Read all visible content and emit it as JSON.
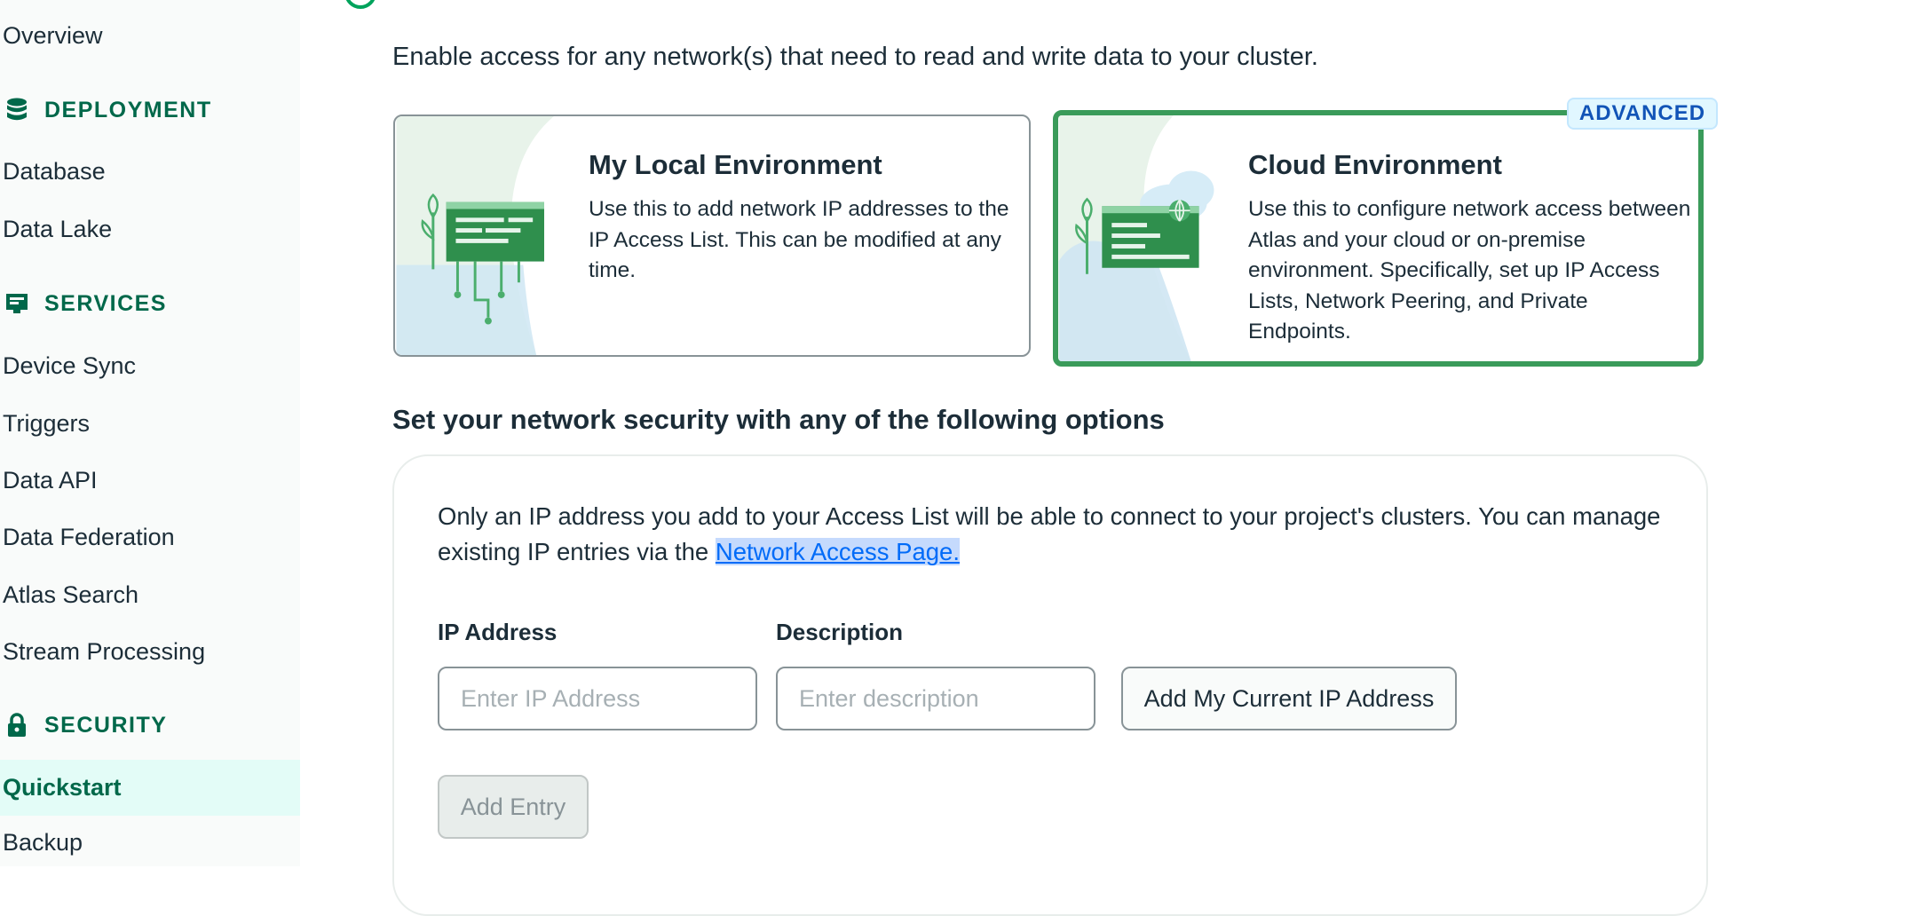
{
  "sidebar": {
    "overview": "Overview",
    "deployment": {
      "heading": "DEPLOYMENT",
      "items": [
        "Database",
        "Data Lake"
      ]
    },
    "services": {
      "heading": "SERVICES",
      "items": [
        "Device Sync",
        "Triggers",
        "Data API",
        "Data Federation",
        "Atlas Search",
        "Stream Processing"
      ]
    },
    "security": {
      "heading": "SECURITY",
      "items": [
        "Quickstart",
        "Backup"
      ],
      "active": "Quickstart"
    }
  },
  "main": {
    "intro": "Enable access for any network(s) that need to read and write data to your cluster.",
    "env_cards": [
      {
        "title": "My Local Environment",
        "description": "Use this to add network IP addresses to the IP Access List. This can be modified at any time."
      },
      {
        "title": "Cloud Environment",
        "description": "Use this to configure network access between Atlas and your cloud or on-premise environment. Specifically, set up IP Access Lists, Network Peering, and Private Endpoints.",
        "badge": "ADVANCED",
        "selected": true
      }
    ],
    "network_section": {
      "title": "Set your network security with any of the following options",
      "description": "Only an IP address you add to your Access List will be able to connect to your project's clusters. You can manage existing IP entries via the ",
      "link": "Network Access Page.",
      "ip_label": "IP Address",
      "ip_placeholder": "Enter IP Address",
      "desc_label": "Description",
      "desc_placeholder": "Enter description",
      "current_ip_button": "Add My Current IP Address",
      "add_entry_button": "Add Entry"
    }
  },
  "colors": {
    "accent": "#00684a",
    "selected_border": "#3a9b5a",
    "link": "#016bf8",
    "active_bg": "#e3fcf7"
  }
}
